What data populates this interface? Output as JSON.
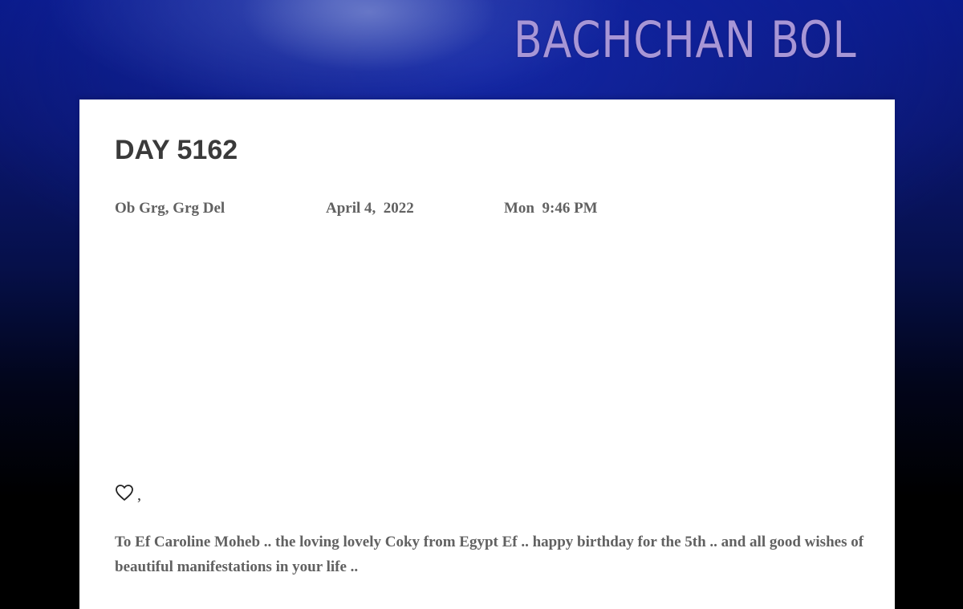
{
  "header": {
    "site_title": "BACHCHAN BOL"
  },
  "post": {
    "title": "DAY 5162",
    "meta": {
      "location": "Ob Grg, Grg Del",
      "date": "April 4,  2022",
      "time": "Mon  9:46 PM"
    },
    "reaction": {
      "icon": "heart-outline-icon",
      "separator": ","
    },
    "body": "To Ef Caroline Moheb .. the loving lovely Coky from Egypt Ef .. happy birthday for the 5th .. and all good wishes of beautiful manifestations in your life .."
  },
  "colors": {
    "background_top": "#0a1a8a",
    "background_bottom": "#000000",
    "site_title": "#a796d6",
    "card": "#ffffff",
    "title_text": "#3a3a3a",
    "meta_text": "#616161"
  }
}
